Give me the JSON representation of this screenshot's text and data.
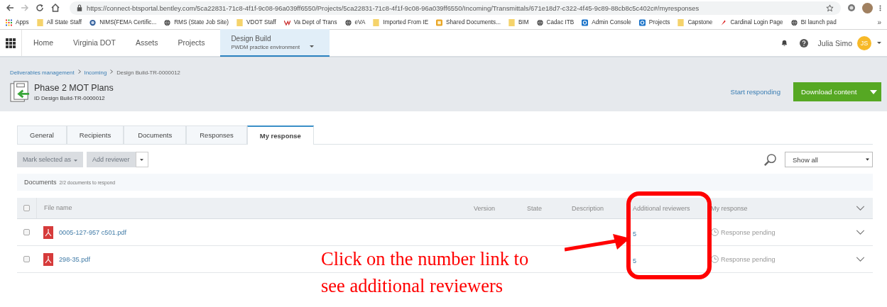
{
  "browser": {
    "url": "https://connect-btsportal.bentley.com/5ca22831-71c8-4f1f-9c08-96a039ff6550/Projects/5ca22831-71c8-4f1f-9c08-96a039ff6550/Incoming/Transmittals/671e18d7-c322-4f45-9c89-88cb8c5c402c#/myresponses",
    "bookmarks": [
      {
        "label": "Apps",
        "kind": "apps"
      },
      {
        "label": "All State Staff",
        "kind": "folder"
      },
      {
        "label": "NIMS(FEMA Certific...",
        "kind": "seal"
      },
      {
        "label": "RMS (State Job Site)",
        "kind": "globe"
      },
      {
        "label": "VDOT Staff",
        "kind": "folder"
      },
      {
        "label": "Va Dept of Trans",
        "kind": "v"
      },
      {
        "label": "eVA",
        "kind": "globe"
      },
      {
        "label": "Imported From IE",
        "kind": "folder"
      },
      {
        "label": "Shared Documents...",
        "kind": "square"
      },
      {
        "label": "BIM",
        "kind": "folder"
      },
      {
        "label": "Cadac ITB",
        "kind": "globe"
      },
      {
        "label": "Admin Console",
        "kind": "portal"
      },
      {
        "label": "Projects",
        "kind": "portal"
      },
      {
        "label": "Capstone",
        "kind": "folder"
      },
      {
        "label": "Cardinal Login Page",
        "kind": "feather"
      },
      {
        "label": "BI launch pad",
        "kind": "globe"
      }
    ],
    "more": "»"
  },
  "nav": {
    "items": [
      {
        "label": "Home",
        "selected": false
      },
      {
        "label": "Virginia DOT",
        "selected": false
      },
      {
        "label": "Assets",
        "selected": false
      },
      {
        "label": "Projects",
        "selected": false
      }
    ],
    "project": {
      "title": "Design Build",
      "subtitle": "PWDM practice environment",
      "selected": true
    },
    "user": {
      "name": "Julia Simo",
      "initials": "JS"
    }
  },
  "breadcrumb": [
    {
      "label": "Deliverables management",
      "link": true
    },
    {
      "label": "Incoming",
      "link": true
    },
    {
      "label": "Design Build-TR-0000012",
      "link": false
    }
  ],
  "header": {
    "title": "Phase 2 MOT Plans",
    "subtitle": "ID Design Build-TR-0000012",
    "start_link": "Start responding",
    "download_button": "Download content"
  },
  "tabs": [
    {
      "label": "General",
      "selected": false
    },
    {
      "label": "Recipients",
      "selected": false
    },
    {
      "label": "Documents",
      "selected": false
    },
    {
      "label": "Responses",
      "selected": false
    },
    {
      "label": "My response",
      "selected": true
    }
  ],
  "toolbar": {
    "buttons": [
      {
        "label": "Mark selected as",
        "disabled": true
      },
      {
        "label": "Add reviewer",
        "disabled": true
      }
    ],
    "filter": "Show all"
  },
  "section": {
    "title": "Documents",
    "count": "2/2 documents to respond"
  },
  "table": {
    "select_all_checked": false,
    "columns": [
      "File name",
      "Version",
      "State",
      "Description",
      "Additional reviewers",
      "My response"
    ],
    "rows": [
      {
        "checked": false,
        "file": "0005-127-957 c501.pdf",
        "additional_reviewers": "5",
        "response": "Response pending"
      },
      {
        "checked": false,
        "file": "298-35.pdf",
        "additional_reviewers": "5",
        "response": "Response pending"
      }
    ]
  },
  "annotation": {
    "text": "Click on the number link to see additional reviewers"
  }
}
